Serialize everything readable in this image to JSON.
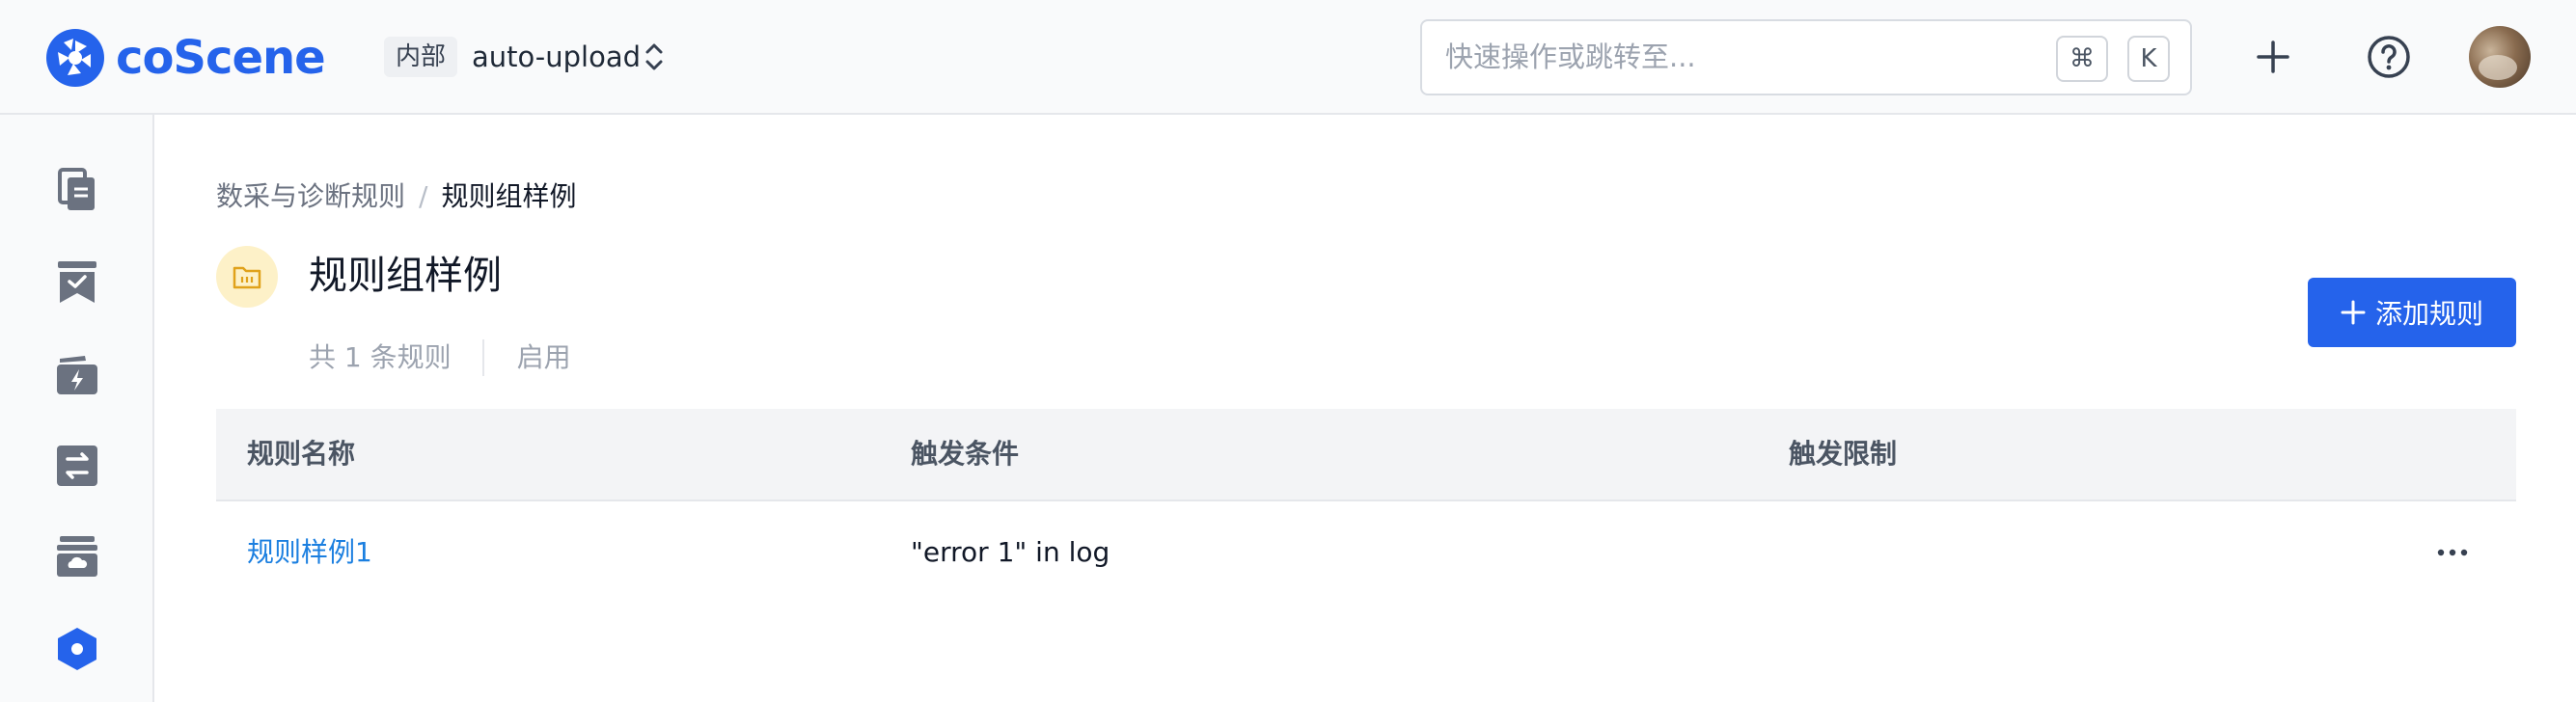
{
  "app": {
    "brand": "coScene",
    "brand_color": "#2563eb"
  },
  "header": {
    "workspace_badge": "内部",
    "project_name": "auto-upload",
    "search": {
      "placeholder": "快速操作或跳转至...",
      "shortcut_cmd": "⌘",
      "shortcut_key": "K"
    },
    "icons": [
      "plus-icon",
      "help-icon",
      "avatar"
    ]
  },
  "sidebar": {
    "items": [
      {
        "icon": "records-icon",
        "active": false
      },
      {
        "icon": "tasks-icon",
        "active": false
      },
      {
        "icon": "actions-folder-icon",
        "active": false
      },
      {
        "icon": "transfer-icon",
        "active": false
      },
      {
        "icon": "cloud-storage-icon",
        "active": false
      },
      {
        "icon": "rules-hexagon-icon",
        "active": true
      }
    ],
    "active_color": "#2563eb"
  },
  "breadcrumb": {
    "parent": "数采与诊断规则",
    "separator": "/",
    "current": "规则组样例"
  },
  "page": {
    "title": "规则组样例",
    "rule_count": "共 1 条规则",
    "status": "启用",
    "add_button": "添加规则"
  },
  "table": {
    "headers": [
      "规则名称",
      "触发条件",
      "触发限制"
    ],
    "rows": [
      {
        "name": "规则样例1",
        "condition": "\"error 1\" in log",
        "limit": ""
      }
    ]
  }
}
